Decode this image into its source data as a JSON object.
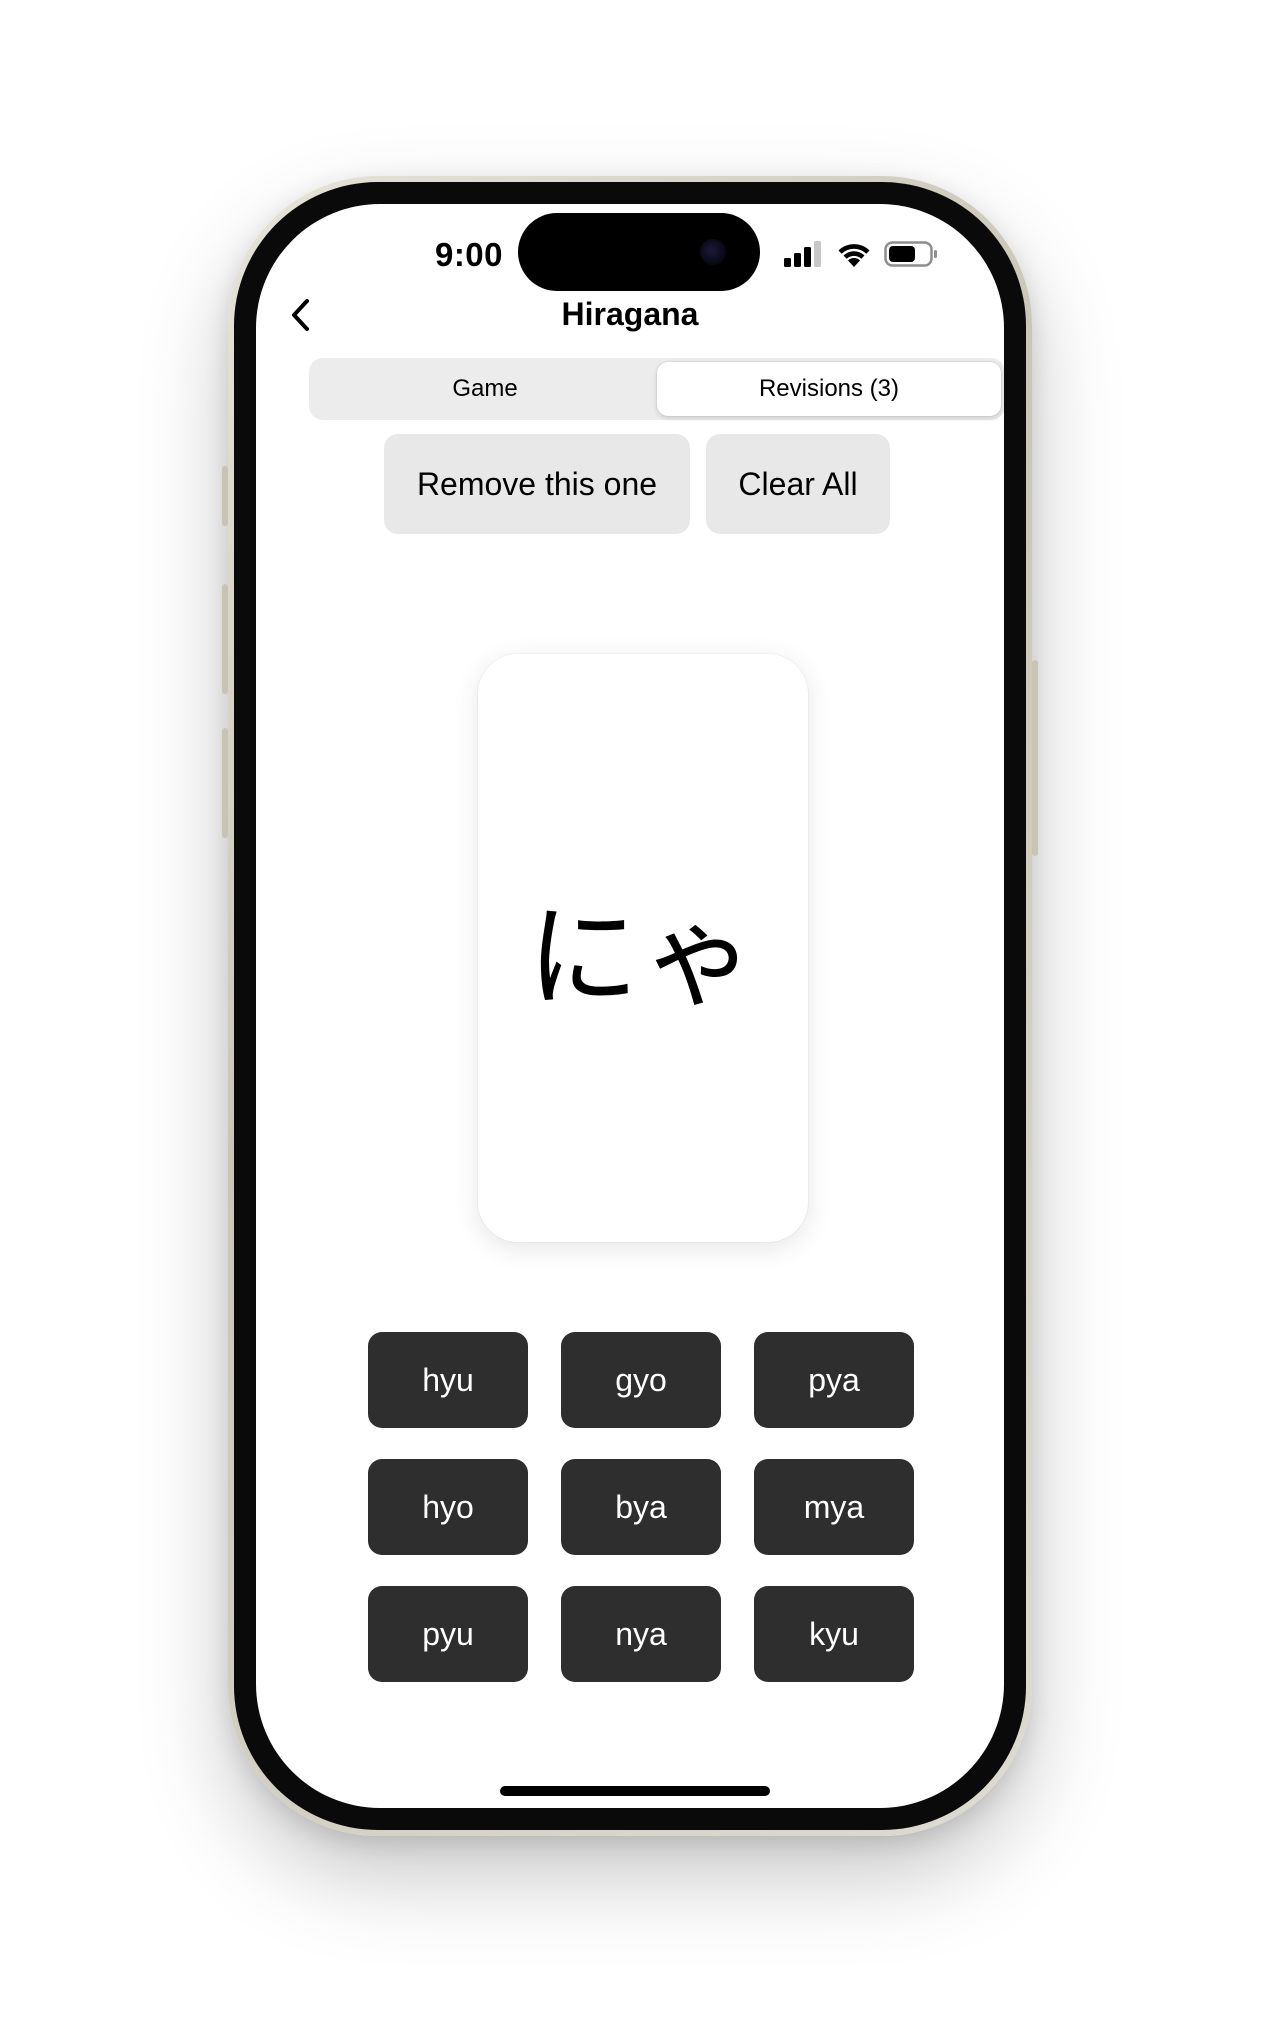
{
  "status_bar": {
    "time": "9:00"
  },
  "nav": {
    "title": "Hiragana"
  },
  "tabs": [
    {
      "label": "Game",
      "active": false
    },
    {
      "label": "Revisions (3)",
      "active": true
    }
  ],
  "actions": {
    "remove_label": "Remove this one",
    "clear_label": "Clear All"
  },
  "card": {
    "kana": "にゃ"
  },
  "answers": [
    "hyu",
    "gyo",
    "pya",
    "hyo",
    "bya",
    "mya",
    "pyu",
    "nya",
    "kyu"
  ],
  "colors": {
    "answer_bg": "#2e2e2e",
    "action_bg": "#e8e8e8",
    "segment_bg": "#ececec"
  }
}
